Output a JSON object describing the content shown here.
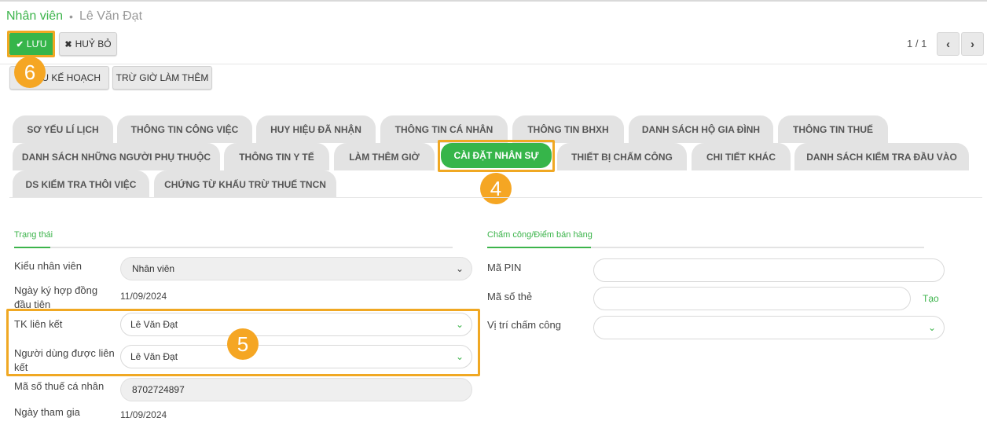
{
  "breadcrumb": {
    "root": "Nhân viên",
    "current": "Lê Văn Đạt"
  },
  "toolbar": {
    "save_label": "LƯU",
    "cancel_label": "HUỶ BỎ",
    "plan_label": "ÂU KẾ HOẠCH",
    "overtime_label": "TRỪ GIỜ LÀM THÊM"
  },
  "pager": {
    "counter": "1 / 1",
    "prev_icon": "chevron-left-icon",
    "next_icon": "chevron-right-icon"
  },
  "badges": {
    "save": "6",
    "tab": "4",
    "linked": "5"
  },
  "tabs": {
    "row1": [
      "SƠ YẾU LÍ LỊCH",
      "THÔNG TIN CÔNG VIỆC",
      "HUY HIỆU ĐÃ NHẬN",
      "THÔNG TIN CÁ NHÂN",
      "THÔNG TIN BHXH",
      "DANH SÁCH HỘ GIA ĐÌNH",
      "THÔNG TIN THUẾ"
    ],
    "row2": [
      "DANH SÁCH NHỮNG NGƯỜI PHỤ THUỘC",
      "THÔNG TIN Y TẾ",
      "LÀM THÊM GIỜ",
      "CÀI ĐẶT NHÂN SỰ",
      "THIẾT BỊ CHẤM CÔNG",
      "CHI TIẾT KHÁC",
      "DANH SÁCH KIỂM TRA ĐẦU VÀO"
    ],
    "row3": [
      "DS KIỂM TRA THÔI VIỆC",
      "CHỨNG TỪ KHẤU TRỪ THUẾ TNCN"
    ],
    "active": "CÀI ĐẶT NHÂN SỰ"
  },
  "status_section": {
    "title": "Trạng thái",
    "employee_type_label": "Kiểu nhân viên",
    "employee_type_value": "Nhân viên",
    "first_contract_label": "Ngày ký hợp đồng đầu tiên",
    "first_contract_value": "11/09/2024",
    "linked_account_label": "TK liên kết",
    "linked_account_value": "Lê Văn Đạt",
    "linked_user_label": "Người dùng được liên kết",
    "linked_user_value": "Lê Văn Đạt",
    "tax_id_label": "Mã số thuế cá nhân",
    "tax_id_value": "8702724897",
    "join_date_label": "Ngày tham gia",
    "join_date_value": "11/09/2024"
  },
  "attendance_section": {
    "title": "Chấm công/Điểm bán hàng",
    "pin_label": "Mã PIN",
    "pin_value": "",
    "card_label": "Mã số thẻ",
    "card_value": "",
    "create_link": "Tạo",
    "location_label": "Vị trí chấm công",
    "location_value": ""
  },
  "colors": {
    "accent": "#36b54a",
    "highlight": "#f0a823",
    "badge": "#f5a623"
  }
}
